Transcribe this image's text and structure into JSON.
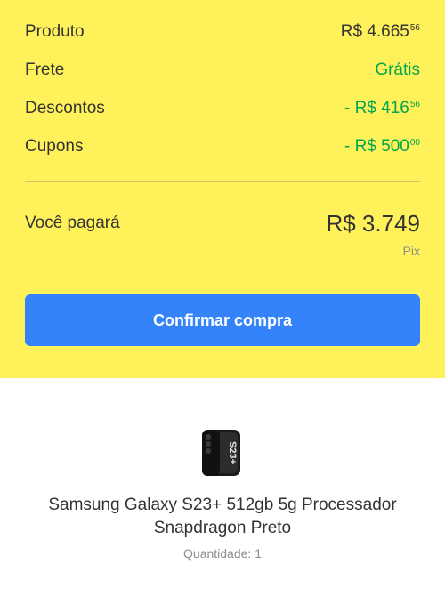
{
  "summary": {
    "rows": [
      {
        "label": "Produto",
        "value_main": "R$ 4.665",
        "value_cents": "56"
      },
      {
        "label": "Frete",
        "value_main": "Grátis",
        "value_cents": ""
      },
      {
        "label": "Descontos",
        "value_main": "- R$ 416",
        "value_cents": "56"
      },
      {
        "label": "Cupons",
        "value_main": "- R$ 500",
        "value_cents": "00"
      }
    ],
    "total_label": "Você pagará",
    "total_value": "R$ 3.749",
    "total_method": "Pix",
    "confirm_label": "Confirmar compra"
  },
  "product": {
    "name": "Samsung Galaxy S23+ 512gb 5g Processador Snapdragon Preto",
    "quantity": "Quantidade: 1",
    "image_text": "S23+"
  },
  "colors": {
    "summary_bg": "#fff159",
    "accent_button": "#3483fa",
    "positive_green": "#00a650"
  }
}
